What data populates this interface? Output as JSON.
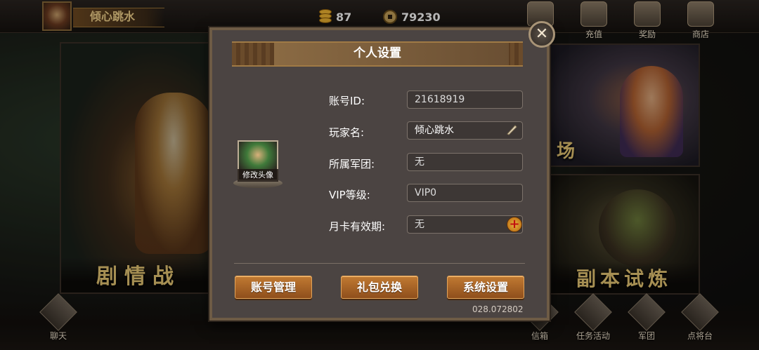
{
  "player": {
    "name": "倾心跳水"
  },
  "resources": {
    "gold": "87",
    "coins": "79230"
  },
  "top_menu": [
    {
      "label": "",
      "icon": "scroll-icon"
    },
    {
      "label": "充值",
      "icon": "treasure-bowl-icon"
    },
    {
      "label": "奖励",
      "icon": "gift-box-icon"
    },
    {
      "label": "商店",
      "icon": "pagoda-shop-icon"
    }
  ],
  "background": {
    "left_panel_caption": "剧情战",
    "right_top_caption": "场",
    "right_bottom_caption": "副本试炼"
  },
  "bottom_menu": [
    {
      "label": "聊天",
      "icon": "chat-bubble-icon"
    },
    {
      "label": "信箱",
      "icon": "mailbox-icon"
    },
    {
      "label": "任务活动",
      "icon": "task-scroll-icon"
    },
    {
      "label": "军团",
      "icon": "legion-banner-icon"
    },
    {
      "label": "点将台",
      "icon": "general-platform-icon"
    }
  ],
  "dialog": {
    "title": "个人设置",
    "avatar_label": "修改头像",
    "fields": [
      {
        "label": "账号ID:",
        "value": "21618919"
      },
      {
        "label": "玩家名:",
        "value": "倾心跳水"
      },
      {
        "label": "所属军团:",
        "value": "无"
      },
      {
        "label": "VIP等级:",
        "value": "VIP0"
      },
      {
        "label": "月卡有效期:",
        "value": "无"
      }
    ],
    "buttons": {
      "account_manage": "账号管理",
      "gift_redeem": "礼包兑换",
      "system_settings": "系统设置"
    },
    "version": "028.072802",
    "close_symbol": "✕"
  }
}
